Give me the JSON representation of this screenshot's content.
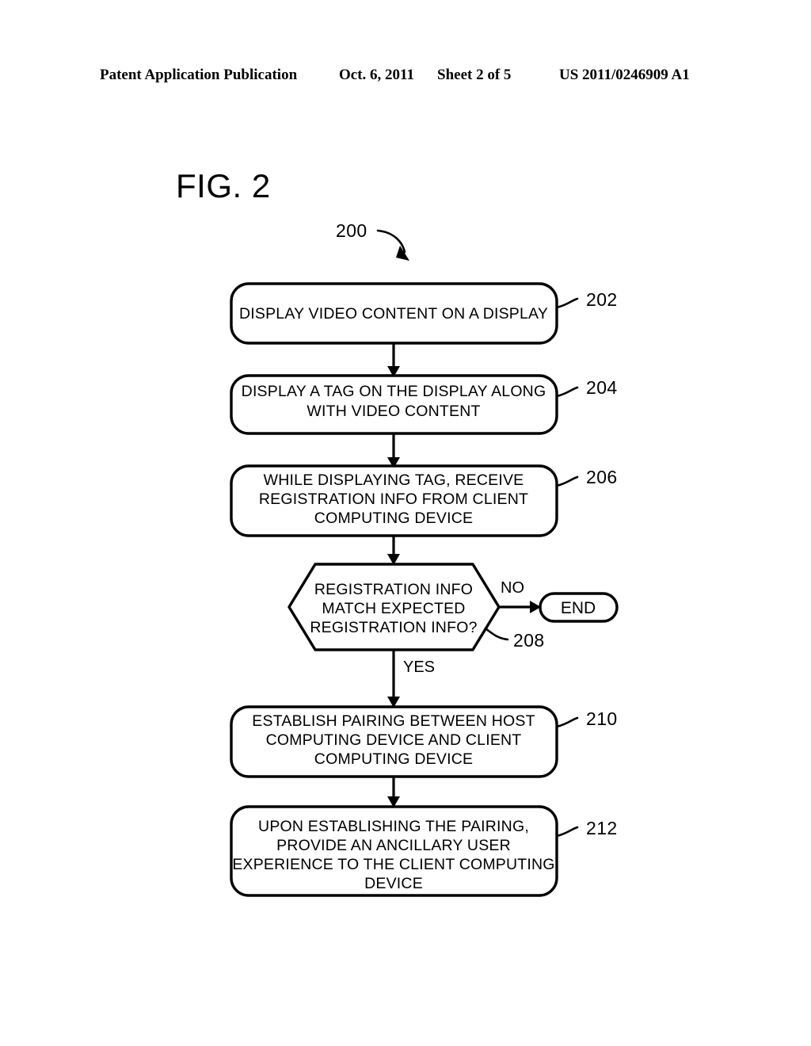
{
  "header": {
    "publication": "Patent Application Publication",
    "date": "Oct. 6, 2011",
    "sheet": "Sheet 2 of 5",
    "patent_number": "US 2011/0246909 A1"
  },
  "figure": {
    "title": "FIG. 2",
    "flow_reference": "200"
  },
  "nodes": [
    {
      "ref": "202",
      "shape": "rounded-rect",
      "lines": [
        "DISPLAY VIDEO CONTENT ON A DISPLAY"
      ]
    },
    {
      "ref": "204",
      "shape": "rounded-rect",
      "lines": [
        "DISPLAY A TAG ON THE DISPLAY ALONG",
        "WITH VIDEO CONTENT"
      ]
    },
    {
      "ref": "206",
      "shape": "rounded-rect",
      "lines": [
        "WHILE DISPLAYING TAG, RECEIVE",
        "REGISTRATION INFO FROM CLIENT",
        "COMPUTING DEVICE"
      ]
    },
    {
      "ref": "208",
      "shape": "hexagon",
      "lines": [
        "REGISTRATION INFO",
        "MATCH EXPECTED",
        "REGISTRATION INFO?"
      ]
    },
    {
      "ref": "210",
      "shape": "rounded-rect",
      "lines": [
        "ESTABLISH PAIRING BETWEEN HOST",
        "COMPUTING DEVICE AND CLIENT",
        "COMPUTING DEVICE"
      ]
    },
    {
      "ref": "212",
      "shape": "rounded-rect",
      "lines": [
        "UPON ESTABLISHING THE PAIRING,",
        "PROVIDE AN ANCILLARY USER",
        "EXPERIENCE TO THE CLIENT COMPUTING",
        "DEVICE"
      ]
    }
  ],
  "terminator": {
    "label": "END"
  },
  "edge_labels": {
    "no": "NO",
    "yes": "YES"
  },
  "colors": {
    "ink": "#000000",
    "paper": "#ffffff"
  }
}
